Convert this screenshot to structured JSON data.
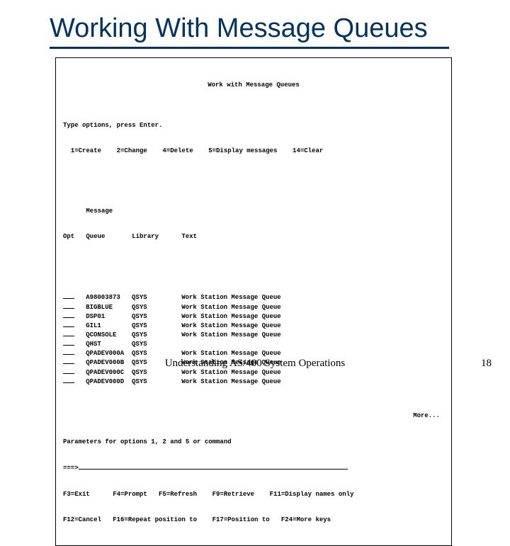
{
  "slide": {
    "title": "Working With Message Queues",
    "caption": "Understanding AS/400 System Operations",
    "page_number": "18"
  },
  "terminal": {
    "title": "Work with Message Queues",
    "instruction": "Type options, press Enter.",
    "options_line": "  1=Create    2=Change    4=Delete    5=Display messages    14=Clear",
    "columns": {
      "opt": "Opt",
      "queue": "Message\nQueue",
      "library": "Library",
      "text": "Text"
    },
    "col_opt": "Opt",
    "col_queue_l1": "Message",
    "col_queue_l2": "Queue",
    "col_library": "Library",
    "col_text": "Text",
    "rows": [
      {
        "queue": "A98003873",
        "library": "QSYS",
        "text": "Work Station Message Queue"
      },
      {
        "queue": "BIGBLUE",
        "library": "QSYS",
        "text": "Work Station Message Queue"
      },
      {
        "queue": "DSP01",
        "library": "QSYS",
        "text": "Work Station Message Queue"
      },
      {
        "queue": "GIL1",
        "library": "QSYS",
        "text": "Work Station Message Queue"
      },
      {
        "queue": "QCONSOLE",
        "library": "QSYS",
        "text": "Work Station Message Queue"
      },
      {
        "queue": "QHST",
        "library": "QSYS",
        "text": ""
      },
      {
        "queue": "QPADEV000A",
        "library": "QSYS",
        "text": "Work Station Message Queue"
      },
      {
        "queue": "QPADEV000B",
        "library": "QSYS",
        "text": "Work Station Message Queue"
      },
      {
        "queue": "QPADEV000C",
        "library": "QSYS",
        "text": "Work Station Message Queue"
      },
      {
        "queue": "QPADEV000D",
        "library": "QSYS",
        "text": "Work Station Message Queue"
      }
    ],
    "more": "More...",
    "param_line": "Parameters for options 1, 2 and 5 or command",
    "prompt": "===>",
    "fkeys_line1": "F3=Exit      F4=Prompt   F5=Refresh    F9=Retrieve    F11=Display names only",
    "fkeys_line2": "F12=Cancel   F16=Repeat position to    F17=Position to   F24=More keys"
  }
}
